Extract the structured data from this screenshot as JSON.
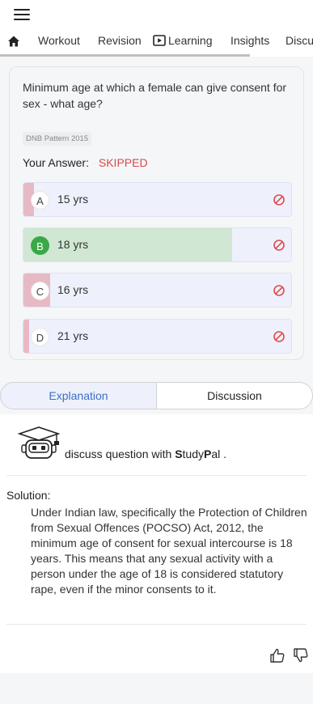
{
  "nav": {
    "tabs": [
      "Workout",
      "Revision",
      "Learning",
      "Insights",
      "Discu"
    ]
  },
  "question": {
    "text": "Minimum age at which a female can give consent for sex - what age?",
    "pattern": "DNB Pattern 2015",
    "answer_label": "Your Answer:",
    "answer_value": "SKIPPED"
  },
  "options": [
    {
      "letter": "A",
      "text": "15 yrs",
      "response_fraction": 0.04
    },
    {
      "letter": "B",
      "text": "18 yrs",
      "response_fraction": 0.78
    },
    {
      "letter": "C",
      "text": "16 yrs",
      "response_fraction": 0.1
    },
    {
      "letter": "D",
      "text": "21 yrs",
      "response_fraction": 0.02
    }
  ],
  "colors": {
    "correct_fill": "#cfe7d3",
    "wrong_fill": "#e7b9c5",
    "accent": "#3a6fc9",
    "skipped": "#d64a4a",
    "correct_badge": "#3aa846"
  },
  "detail_tabs": {
    "explanation": "Explanation",
    "discussion": "Discussion"
  },
  "studypal": {
    "prefix": "discuss question with ",
    "brand_s": "S",
    "brand_tudy": "tudy",
    "brand_p": "P",
    "brand_al": "al",
    "suffix": " ."
  },
  "solution": {
    "label": "Solution:",
    "text": "Under Indian law, specifically the Protection of Children from Sexual Offences (POCSO) Act, 2012, the minimum age of consent for sexual intercourse is 18 years. This means that any sexual activity with a person under the age of 18 is considered statutory rape, even if the minor consents to it."
  },
  "icons": {
    "menu": "hamburger-icon",
    "home": "home-icon",
    "learning": "play-box-icon",
    "not_allowed": "no-entry-icon",
    "thumbs_up": "thumbs-up-icon",
    "thumbs_down": "thumbs-down-icon"
  }
}
